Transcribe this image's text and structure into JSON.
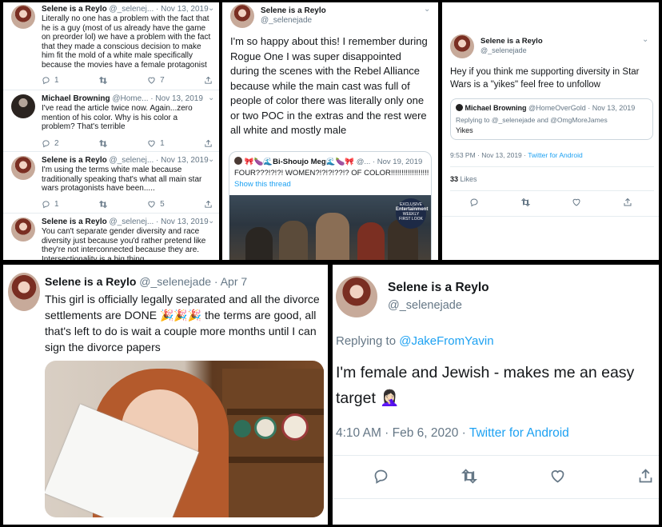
{
  "panel1": {
    "tweets": [
      {
        "name": "Selene is a Reylo",
        "handle": "@_selenej...",
        "date": "· Nov 13, 2019",
        "text": "Literally no one has a problem with the fact that he is a guy (most of us already have the game on preorder lol) we have a problem with the fact that they made a conscious decision to make him fit the mold of a white male specifically because the movies have a female protagonist",
        "replies": "1",
        "likes": "7"
      },
      {
        "name": "Michael Browning",
        "handle": "@Home...",
        "date": "· Nov 13, 2019",
        "text": "I've read the article twice now. Again...zero mention of his color. Why is his color a problem? That's terrible",
        "replies": "2",
        "likes": "1"
      },
      {
        "name": "Selene is a Reylo",
        "handle": "@_selenej...",
        "date": "· Nov 13, 2019",
        "text": "I'm using the terms white male because traditionally speaking that's what all main star wars protagonists have been.....",
        "replies": "1",
        "likes": "5"
      },
      {
        "name": "Selene is a Reylo",
        "handle": "@_selenej...",
        "date": "· Nov 13, 2019",
        "text": "You can't separate gender diversity and race diversity just because you'd rather pretend like they're not interconnected because they are. Intersectionality is a big thing"
      }
    ]
  },
  "panel2": {
    "name": "Selene is a Reylo",
    "handle": "@_selenejade",
    "text": "I'm so happy about this! I remember during Rogue One I was super disappointed during the scenes with the Rebel Alliance because while the main cast was full of people of color there was literally only one or two POC in the extras and the rest were all white and mostly male",
    "quote": {
      "name": "🎀🍆🌊Bi-Shoujo Meg🌊🍆🎀",
      "handle": "@...",
      "date": "· Nov 19, 2019",
      "text": "FOUR???!?!?! WOMEN?!?!?!??!? OF COLOR!!!!!!!!!!!!!!!!!!",
      "link": "Show this thread",
      "badge_top": "EXCLUSIVE",
      "badge_main": "Entertainment",
      "badge_sub": "WEEKLY",
      "badge_bottom": "FIRST LOOK"
    }
  },
  "panel3": {
    "name": "Selene is a Reylo",
    "handle": "@_selenejade",
    "text": "Hey if you think me supporting diversity in Star Wars is a \"yikes\" feel free to unfollow",
    "quote": {
      "name": "Michael Browning",
      "handle": "@HomeOverGold",
      "date": "· Nov 13, 2019",
      "replying": "Replying to @_selenejade and @OmgMoreJames",
      "text": "Yikes"
    },
    "time": "9:53 PM · Nov 13, 2019 · ",
    "source": "Twitter for Android",
    "likes_count": "33",
    "likes_label": "Likes"
  },
  "panel4": {
    "name": "Selene is a Reylo",
    "handle": "@_selenejade",
    "date": "· Apr 7",
    "text": "This girl is officially legally separated and all the divorce settlements are DONE 🎉🎉🎉 the terms are good, all that's left to do is wait a couple more months until I can sign the divorce papers"
  },
  "panel5": {
    "name": "Selene is a Reylo",
    "handle": "@_selenejade",
    "replying_label": "Replying to ",
    "replying_user": "@JakeFromYavin",
    "text": "I'm female and Jewish - makes me an easy target 🤦🏻‍♀️",
    "time": "4:10 AM · Feb 6, 2020 · ",
    "source": "Twitter for Android"
  },
  "colors": {
    "accent": "#1da1f2",
    "muted": "#657786",
    "divider": "#e6ecf0"
  },
  "icons": [
    "reply-icon",
    "retweet-icon",
    "like-icon",
    "share-icon",
    "chevron-down-icon"
  ]
}
